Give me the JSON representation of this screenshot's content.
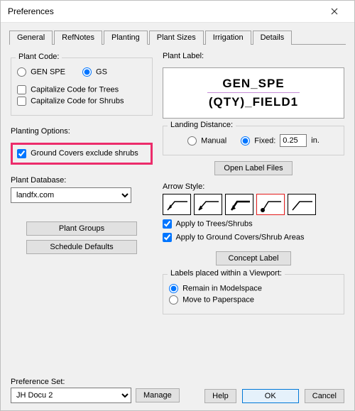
{
  "window": {
    "title": "Preferences"
  },
  "tabs": [
    "General",
    "RefNotes",
    "Planting",
    "Plant Sizes",
    "Irrigation",
    "Details"
  ],
  "active_tab_index": 2,
  "left": {
    "plant_code": {
      "title": "Plant Code:",
      "opt_genspe": "GEN SPE",
      "opt_gs": "GS",
      "cap_trees": "Capitalize Code for Trees",
      "cap_shrubs": "Capitalize Code for Shrubs"
    },
    "planting_options": {
      "title": "Planting Options:",
      "gc_exclude": "Ground Covers exclude shrubs"
    },
    "plant_db": {
      "title": "Plant Database:",
      "value": "landfx.com"
    },
    "buttons": {
      "plant_groups": "Plant Groups",
      "schedule_defaults": "Schedule Defaults"
    }
  },
  "right": {
    "plant_label_title": "Plant Label:",
    "preview_line1": "GEN_SPE",
    "preview_line2": "(QTY)_FIELD1",
    "landing": {
      "title": "Landing Distance:",
      "manual": "Manual",
      "fixed": "Fixed:",
      "value": "0.25",
      "unit": "in."
    },
    "open_label_files": "Open Label Files",
    "arrow_title": "Arrow Style:",
    "apply_trees": "Apply to Trees/Shrubs",
    "apply_gc": "Apply to Ground Covers/Shrub Areas",
    "concept_label": "Concept Label",
    "viewport": {
      "title": "Labels placed within a Viewport:",
      "remain": "Remain in Modelspace",
      "move": "Move to Paperspace"
    }
  },
  "bottom": {
    "pref_set_title": "Preference Set:",
    "pref_set_value": "JH Docu 2",
    "manage": "Manage",
    "help": "Help",
    "ok": "OK",
    "cancel": "Cancel"
  }
}
